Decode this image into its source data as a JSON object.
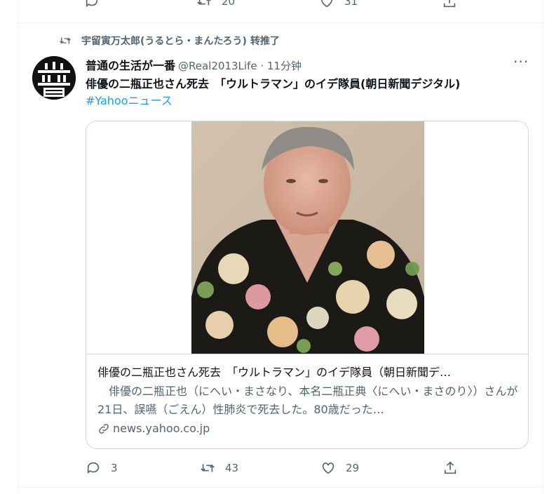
{
  "previous_tweet": {
    "actions": [
      {
        "name": "reply",
        "count": ""
      },
      {
        "name": "retweet",
        "count": "20"
      },
      {
        "name": "like",
        "count": "31"
      },
      {
        "name": "share",
        "count": ""
      }
    ]
  },
  "retweet_header": {
    "text": "宇留寅万太郎(うるとら・まんたろう) 转推了",
    "icon": "retweet-icon"
  },
  "tweet": {
    "author_name": "普通の生活が一番",
    "author_meta": "@Real2013Life · 11分钟",
    "more_label": "···",
    "text": "俳優の二瓶正也さん死去　「ウルトラマン」のイデ隊員(朝日新聞デジタル)",
    "hashtag": "#Yahooニュース",
    "card": {
      "title": "俳優の二瓶正也さん死去　「ウルトラマン」のイデ隊員（朝日新聞デ…",
      "description": "　俳優の二瓶正也（にへい・まさなり、本名二瓶正典〈にへい・まさのり〉）さんが21日、誤嚥（ごえん）性肺炎で死去した。80歳だった…",
      "domain": "news.yahoo.co.jp",
      "domain_icon": "link-icon"
    },
    "actions": {
      "reply_count": "3",
      "retweet_count": "43",
      "like_count": "29"
    }
  },
  "colors": {
    "accent": "#1d9bf0",
    "muted": "#536471",
    "border": "#cfd9de"
  }
}
